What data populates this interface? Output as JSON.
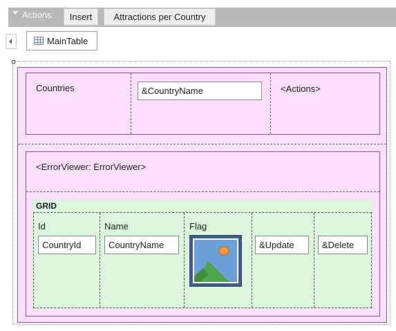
{
  "toolbar": {
    "actions_label": "Actions",
    "insert_label": "Insert",
    "attractions_label": "Attractions per Country"
  },
  "tabs": {
    "main_table_label": "MainTable"
  },
  "form": {
    "countries_label": "Countries",
    "country_name_value": "&CountryName",
    "actions_placeholder": "<Actions>",
    "error_viewer_label": "<ErrorViewer: ErrorViewer>"
  },
  "grid": {
    "title": "GRID",
    "columns": [
      {
        "label": "Id",
        "field": "CountryId"
      },
      {
        "label": "Name",
        "field": "CountryName"
      },
      {
        "label": "Flag",
        "field": ""
      },
      {
        "label": "",
        "field": "&Update"
      },
      {
        "label": "",
        "field": "&Delete"
      }
    ]
  },
  "colors": {
    "toolbar_bg": "#b9b9b9",
    "table_bg": "#fde0fd",
    "table_border": "#9e4c9e",
    "grid_bg": "#dcf7dc"
  },
  "icons": [
    "chevron-down-icon",
    "chevron-left-icon",
    "table-icon",
    "image-placeholder-icon"
  ]
}
